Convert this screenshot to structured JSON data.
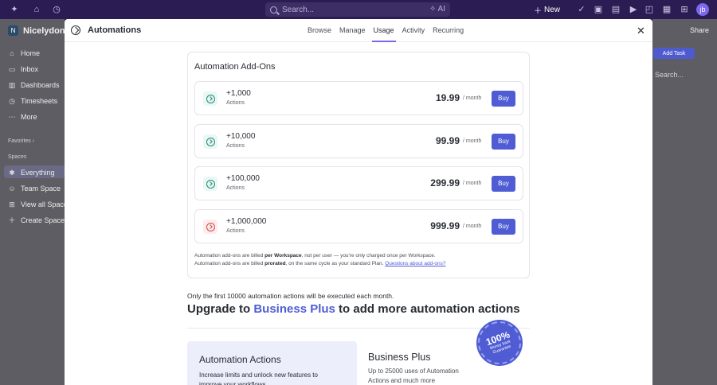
{
  "topbar": {
    "search_placeholder": "Search...",
    "ai_label": "AI",
    "new_label": "New",
    "avatar_initial": "jb"
  },
  "sidebar": {
    "workspace_initial": "N",
    "workspace_name": "Nicelydone",
    "items": [
      {
        "label": "Home",
        "icon": "home-icon"
      },
      {
        "label": "Inbox",
        "icon": "inbox-icon"
      },
      {
        "label": "Dashboards",
        "icon": "dashboard-icon"
      },
      {
        "label": "Timesheets",
        "icon": "timesheet-icon"
      },
      {
        "label": "More",
        "icon": "more-icon"
      }
    ],
    "favorites_label": "Favorites",
    "spaces_label": "Spaces",
    "spaces": [
      {
        "label": "Everything",
        "icon": "everything-icon"
      },
      {
        "label": "Team Space",
        "icon": "users-icon"
      },
      {
        "label": "View all Spaces",
        "icon": "grid-icon"
      },
      {
        "label": "Create Space",
        "icon": "plus-icon"
      }
    ]
  },
  "background": {
    "share_label": "Share",
    "add_task_label": "Add Task",
    "search_label": "Search..."
  },
  "modal": {
    "title": "Automations",
    "tabs": [
      {
        "label": "Browse",
        "active": false
      },
      {
        "label": "Manage",
        "active": false
      },
      {
        "label": "Usage",
        "active": true
      },
      {
        "label": "Activity",
        "active": false
      },
      {
        "label": "Recurring",
        "active": false
      }
    ],
    "addons": {
      "title": "Automation Add-Ons",
      "per_label": "/ month",
      "buy_label": "Buy",
      "rows": [
        {
          "amount": "+1,000",
          "unit": "Actions",
          "price": "19.99"
        },
        {
          "amount": "+10,000",
          "unit": "Actions",
          "price": "99.99"
        },
        {
          "amount": "+100,000",
          "unit": "Actions",
          "price": "299.99"
        },
        {
          "amount": "+1,000,000",
          "unit": "Actions",
          "price": "999.99"
        }
      ],
      "note1_a": "Automation add-ons are billed ",
      "note1_b": "per Workspace",
      "note1_c": ", not per user — you're only charged once per Workspace.",
      "note2_a": "Automation add-ons are billed ",
      "note2_b": "prorated",
      "note2_c": ", on the same cycle as your standard Plan. ",
      "note2_link": "Questions about add-ons?"
    },
    "limit_text": "Only the first 10000 automation actions will be executed each month.",
    "upgrade_prefix": "Upgrade to ",
    "upgrade_plan": "Business Plus",
    "upgrade_suffix": " to add more automation actions",
    "actions_card": {
      "title": "Automation Actions",
      "desc": "Increase limits and unlock new features to improve your workflows"
    },
    "business_plus": {
      "title": "Business Plus",
      "desc": "Up to 25000 uses of Automation Actions and much more"
    },
    "badge": {
      "pct": "100%",
      "line1": "Money back",
      "line2": "Guarantee"
    }
  }
}
